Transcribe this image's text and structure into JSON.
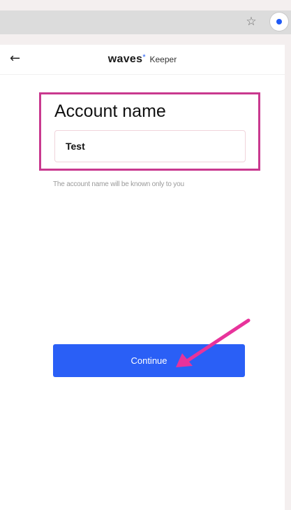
{
  "browser": {
    "star_icon": "star-outline",
    "extension_icon": "waves-keeper-extension"
  },
  "popup": {
    "header": {
      "back_icon": "arrow-left",
      "brand_name": "waves",
      "brand_mark": "*",
      "brand_suffix": "Keeper"
    },
    "form": {
      "title": "Account name",
      "input_value": "Test",
      "helper_text": "The account name will be known only to you"
    },
    "continue_label": "Continue"
  },
  "colors": {
    "highlight": "#c9398f",
    "arrow": "#e8339b",
    "button": "#2a5ff6",
    "brand_star": "#1f5af6"
  }
}
